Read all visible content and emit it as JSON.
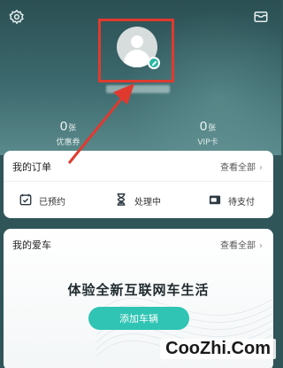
{
  "stats": [
    {
      "value": "0",
      "unit": "张",
      "label": "优惠券"
    },
    {
      "value": "0",
      "unit": "张",
      "label": "VIP卡"
    }
  ],
  "orders": {
    "title": "我的订单",
    "more": "查看全部",
    "items": [
      {
        "label": "已预约",
        "icon": "calendar-check-icon"
      },
      {
        "label": "处理中",
        "icon": "hourglass-icon"
      },
      {
        "label": "待支付",
        "icon": "wallet-icon"
      }
    ]
  },
  "cars": {
    "title": "我的爱车",
    "more": "查看全部",
    "slogan": "体验全新互联网车生活",
    "add_button": "添加车辆"
  },
  "watermark": "CooZhi.Com",
  "colors": {
    "accent": "#2fc4b4",
    "highlight_box": "#e03a2f",
    "header_bg": "#2f5559"
  }
}
